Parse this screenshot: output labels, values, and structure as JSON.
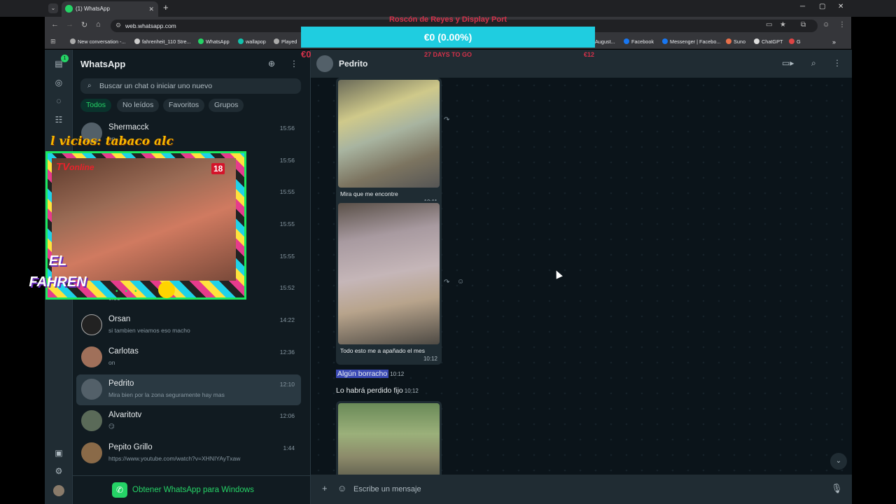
{
  "browser": {
    "tab_title": "(1) WhatsApp",
    "url": "web.whatsapp.com",
    "bookmarks": [
      "New conversation -...",
      "fahrenheit_110 Stre...",
      "WhatsApp",
      "wallapop",
      "Played",
      "August...",
      "Facebook",
      "Messenger | Facebo...",
      "Suno",
      "ChatGPT",
      "G"
    ]
  },
  "overlay": {
    "title": "Roscón de Reyes y Display Port",
    "progress_text": "€0 (0.00%)",
    "progress_fraction": 0.0,
    "min_label": "€0",
    "days_left": "27 DAYS TO GO",
    "max_label": "€12"
  },
  "whatsapp": {
    "title": "WhatsApp",
    "rail_badge": "1",
    "search_placeholder": "Buscar un chat o iniciar uno nuevo",
    "filters": [
      "Todos",
      "No leídos",
      "Favoritos",
      "Grupos"
    ],
    "chats": [
      {
        "name": "Shermacck",
        "preview": "on",
        "time": "15:56"
      },
      {
        "name": "",
        "preview": "",
        "time": "15:56"
      },
      {
        "name": "",
        "preview": "",
        "time": "15:55"
      },
      {
        "name": "",
        "preview": "",
        "time": "15:55"
      },
      {
        "name": "",
        "preview": "",
        "time": "15:55"
      },
      {
        "name": "",
        "preview": "0:01",
        "time": "15:52"
      },
      {
        "name": "Orsan",
        "preview": "si tambien veiamos eso macho",
        "time": "14:22"
      },
      {
        "name": "Carlotas",
        "preview": "on",
        "time": "12:36"
      },
      {
        "name": "Pedrito",
        "preview": "Mira bien por la zona seguramente hay mas",
        "time": "12:10"
      },
      {
        "name": "Alvaritotv",
        "preview": "😏",
        "time": "12:06"
      },
      {
        "name": "Pepito Grillo",
        "preview": "https://www.youtube.com/watch?v=XHNIYAyTxaw",
        "time": "1:44"
      }
    ],
    "banner": "Obtener WhatsApp para Windows",
    "conversation": {
      "name": "Pedrito",
      "messages": [
        {
          "caption": "Mira que me encontre",
          "time": "10:11"
        },
        {
          "caption": "Todo  esto me a apañado el mes",
          "time": "10:12"
        },
        {
          "text": "Algún borracho",
          "time": "10:12"
        },
        {
          "text": "Lo habrá perdido fijo",
          "time": "10:12"
        }
      ],
      "composer_placeholder": "Escribe un mensaje"
    }
  },
  "webcam": {
    "title": "l vicios: tabaco alc",
    "tv_label": "TV",
    "tv_sub": "online",
    "age": "18",
    "logo": "EL FAHREN"
  }
}
